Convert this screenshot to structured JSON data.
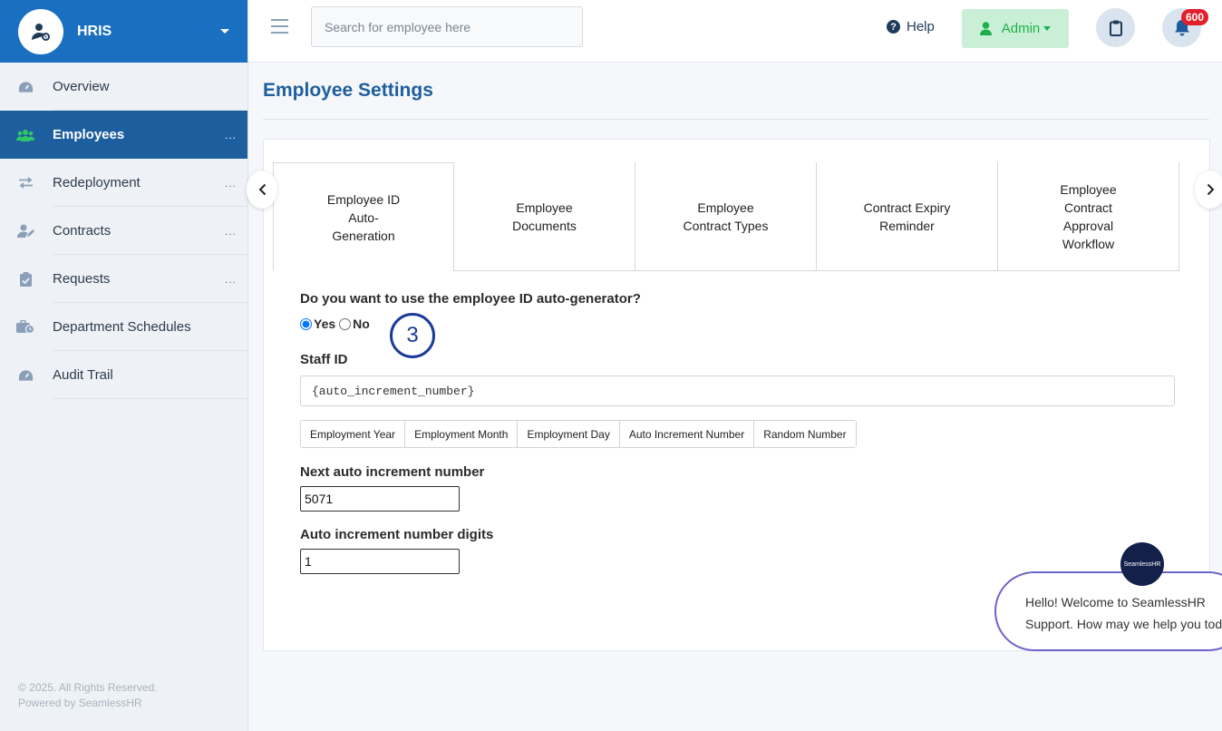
{
  "brand": {
    "title": "HRIS"
  },
  "sidebar": {
    "items": [
      {
        "label": "Overview",
        "icon": "dashboard-icon",
        "more": ""
      },
      {
        "label": "Employees",
        "icon": "users-icon",
        "more": "...",
        "active": true
      },
      {
        "label": "Redeployment",
        "icon": "swap-icon",
        "more": "..."
      },
      {
        "label": "Contracts",
        "icon": "user-edit-icon",
        "more": "..."
      },
      {
        "label": "Requests",
        "icon": "clipboard-check-icon",
        "more": "..."
      },
      {
        "label": "Department Schedules",
        "icon": "briefcase-clock-icon",
        "more": ""
      },
      {
        "label": "Audit Trail",
        "icon": "dashboard-icon",
        "more": ""
      }
    ],
    "footer_line1": "© 2025. All Rights Reserved.",
    "footer_line2": "Powered by SeamlessHR"
  },
  "header": {
    "search_placeholder": "Search for employee here",
    "help_label": "Help",
    "admin_label": "Admin",
    "notification_count": "600"
  },
  "page": {
    "title": "Employee Settings",
    "tabs": [
      {
        "label": "Employee ID Auto-Generation",
        "active": true
      },
      {
        "label": "Employee Documents"
      },
      {
        "label": "Employee Contract Types"
      },
      {
        "label": "Contract Expiry Reminder"
      },
      {
        "label": "Employee Contract Approval Workflow"
      }
    ],
    "question": "Do you want to use the employee ID auto-generator?",
    "yes_label": "Yes",
    "no_label": "No",
    "selected": "Yes",
    "step_number": "3",
    "staff_id_label": "Staff ID",
    "staff_id_value": "{auto_increment_number}",
    "tokens": [
      "Employment Year",
      "Employment Month",
      "Employment Day",
      "Auto Increment Number",
      "Random Number"
    ],
    "next_increment_label": "Next auto increment number",
    "next_increment_value": "5071",
    "digits_label": "Auto increment number digits",
    "digits_value": "1"
  },
  "chat": {
    "brand": "SeamlessHR",
    "line1": "Hello! Welcome to SeamlessHR",
    "line2": "Support. How may we help you today?"
  },
  "colors": {
    "primary": "#1a6fc0",
    "sidebar_active": "#1d5e9e",
    "admin_bg": "#c9f0d6",
    "admin_text": "#1db04a",
    "badge": "#e0202a",
    "step_badge": "#1b3a9a"
  }
}
